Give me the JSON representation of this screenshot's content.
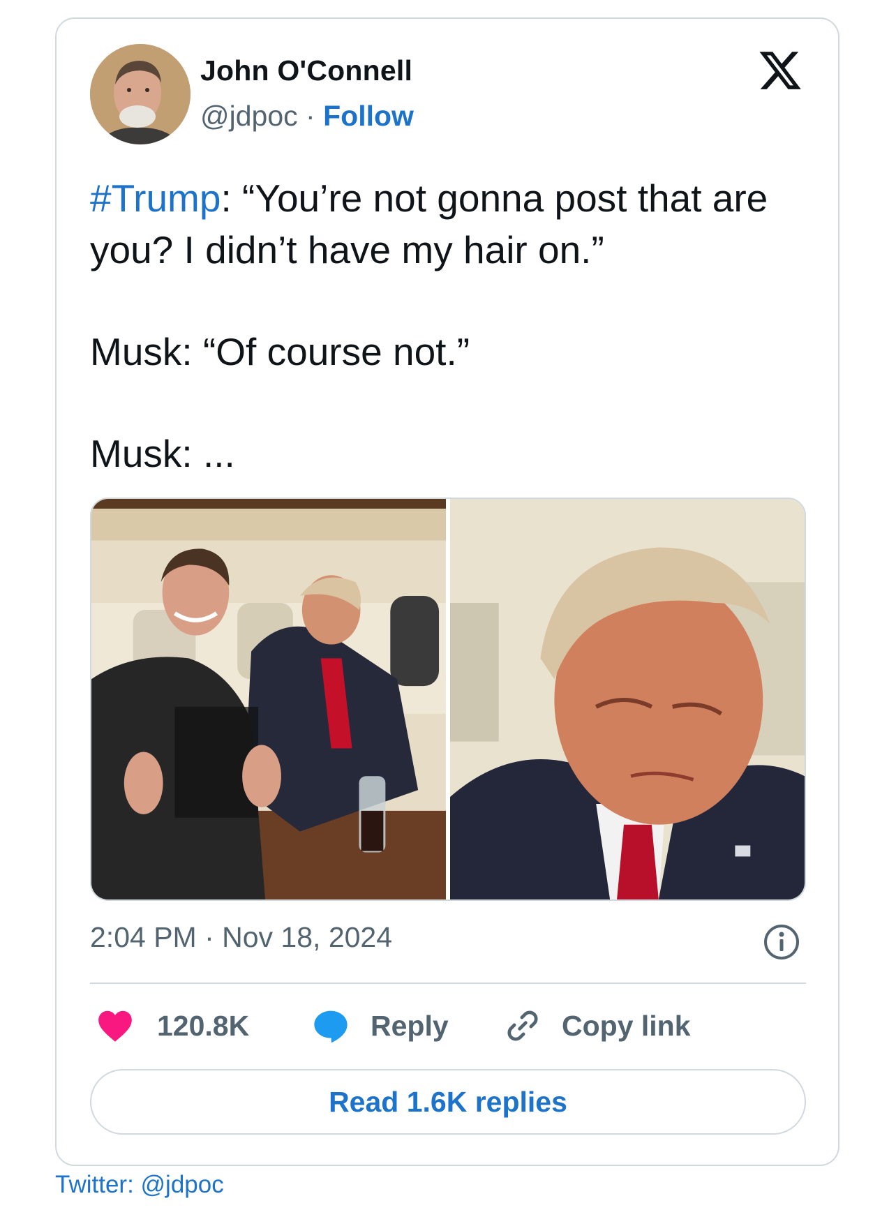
{
  "author": {
    "name": "John O'Connell",
    "handle": "@jdpoc",
    "separator": "·",
    "follow_label": "Follow"
  },
  "tweet": {
    "hashtag": "#Trump",
    "line1_rest": ": “You’re not gonna post that are you? I didn’t have my hair on.”",
    "line2": "Musk: “Of course not.”",
    "line3": "Musk: ..."
  },
  "meta": {
    "timestamp": "2:04 PM · Nov 18, 2024"
  },
  "actions": {
    "likes_count": "120.8K",
    "reply_label": "Reply",
    "copy_link_label": "Copy link"
  },
  "read_replies_label": "Read 1.6K replies",
  "credit": "Twitter: @jdpoc",
  "colors": {
    "link_blue": "#1d73c9",
    "heart_pink": "#f91880",
    "reply_blue": "#1d9bf0",
    "secondary_text": "#536471",
    "border": "#cfd9de"
  },
  "icons": [
    "x-logo-icon",
    "info-icon",
    "heart-icon",
    "reply-bubble-icon",
    "link-icon"
  ]
}
